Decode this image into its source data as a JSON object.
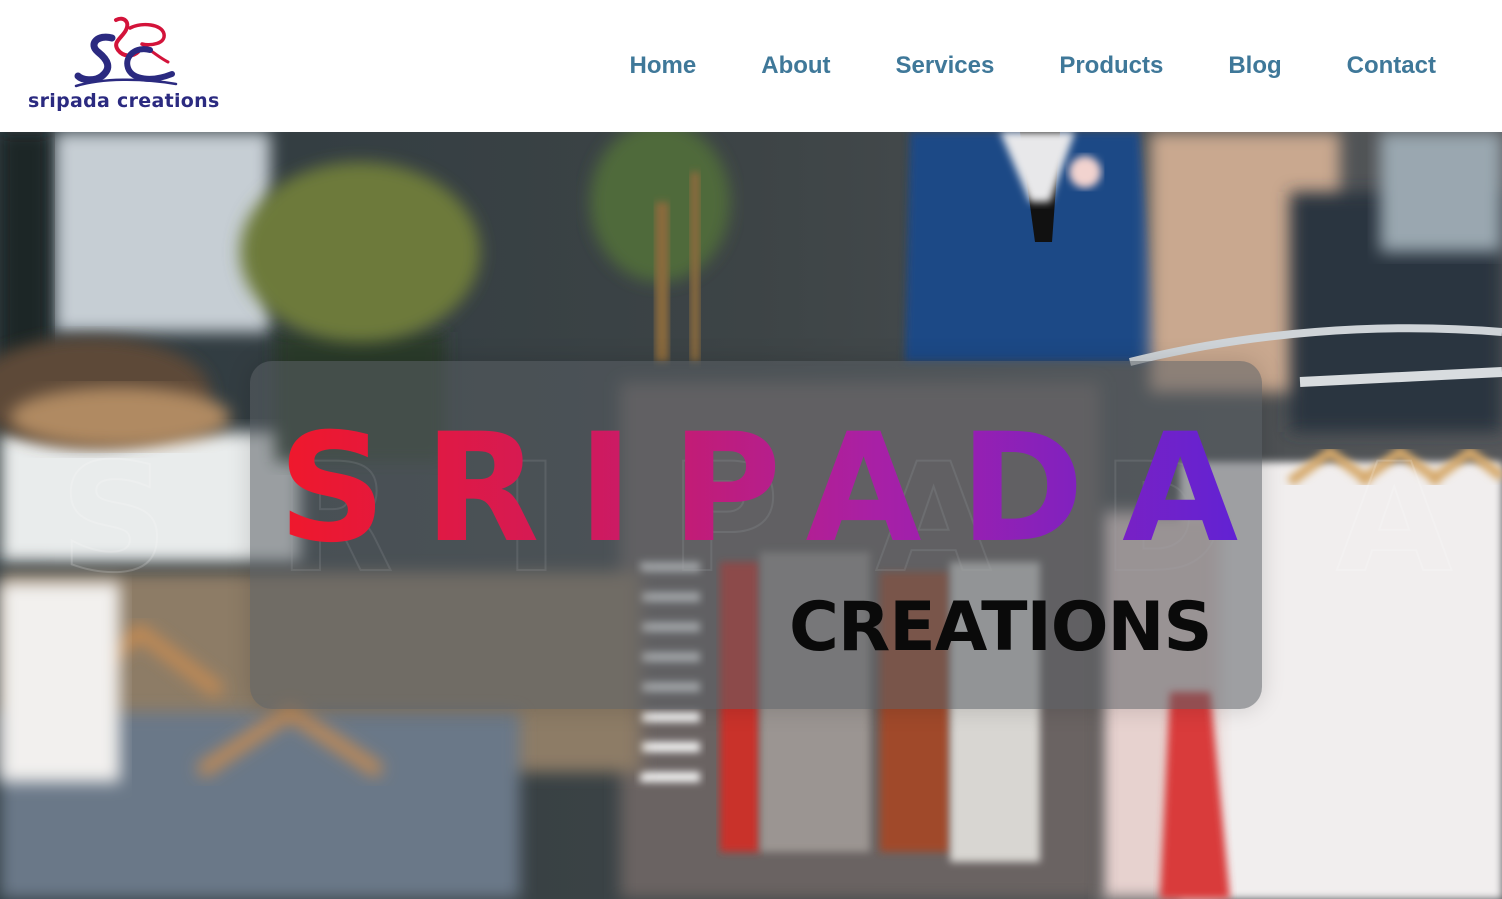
{
  "header": {
    "logo": {
      "icon": "sripada-creations-logo-icon",
      "text": "sripada creations",
      "colors": {
        "navy": "#2b2a80",
        "red": "#d3133a"
      }
    },
    "nav": [
      {
        "label": "Home"
      },
      {
        "label": "About"
      },
      {
        "label": "Services"
      },
      {
        "label": "Products"
      },
      {
        "label": "Blog"
      },
      {
        "label": "Contact"
      }
    ],
    "nav_color": "#3f7899"
  },
  "hero": {
    "background": "clothing-store-photo",
    "wordmark": "SRIPADA",
    "wordmark_gradient": [
      "#f0182b",
      "#d11a5a",
      "#a820a6",
      "#5a22d8"
    ],
    "subtitle": "CREATIONS",
    "subtitle_color": "#0a0a0a"
  }
}
